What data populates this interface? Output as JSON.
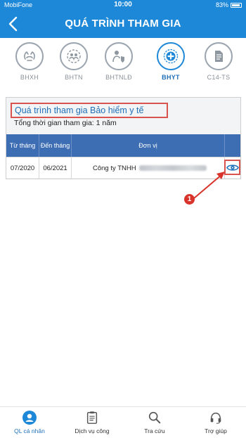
{
  "status_bar": {
    "carrier": "MobiFone",
    "time": "10:00",
    "battery": "83%"
  },
  "header": {
    "title": "QUÁ TRÌNH THAM GIA"
  },
  "tabs": [
    {
      "label": "BHXH",
      "icon": "hands-icon",
      "active": false
    },
    {
      "label": "BHTN",
      "icon": "people-circle-icon",
      "active": false
    },
    {
      "label": "BHTNLĐ",
      "icon": "worker-shield-icon",
      "active": false
    },
    {
      "label": "BHYT",
      "icon": "medical-cross-icon",
      "active": true
    },
    {
      "label": "C14-TS",
      "icon": "document-icon",
      "active": false
    }
  ],
  "panel": {
    "title": "Quá trình tham gia Bảo hiểm y tế",
    "subtitle": "Tổng thời gian tham gia: 1 năm"
  },
  "table": {
    "headers": [
      "Từ tháng",
      "Đến tháng",
      "Đơn vị",
      ""
    ],
    "rows": [
      {
        "from": "07/2020",
        "to": "06/2021",
        "unit": "Công ty TNHH",
        "action_icon": "eye-icon"
      }
    ]
  },
  "annotation": {
    "badge": "1"
  },
  "bottom_nav": [
    {
      "label": "QL cá nhân",
      "icon": "user-circle-icon",
      "active": true
    },
    {
      "label": "Dịch vụ công",
      "icon": "clipboard-icon",
      "active": false
    },
    {
      "label": "Tra cứu",
      "icon": "search-icon",
      "active": false
    },
    {
      "label": "Trợ giúp",
      "icon": "headset-icon",
      "active": false
    }
  ],
  "colors": {
    "brand_blue": "#1e88d8",
    "table_header": "#3d6eb3",
    "highlight_red": "#d9534f"
  }
}
